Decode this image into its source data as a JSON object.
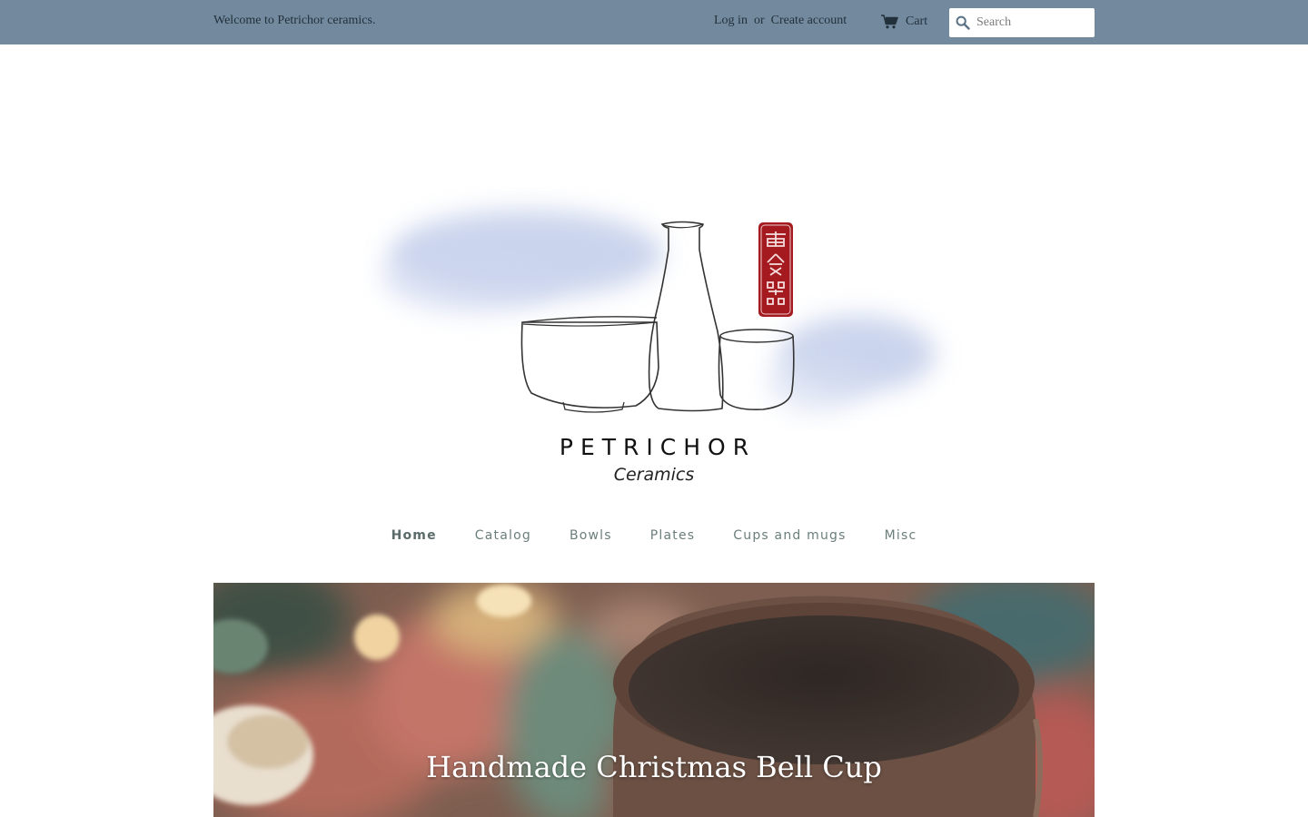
{
  "header": {
    "welcome": "Welcome to Petrichor ceramics.",
    "login_label": "Log in",
    "or_text": "or",
    "create_account_label": "Create account",
    "cart_label": "Cart",
    "cart_icon": "cart-icon",
    "search_icon": "search-icon",
    "search_placeholder": "Search",
    "bar_color": "#738a9e"
  },
  "logo": {
    "brand": "PETRICHOR",
    "subtitle": "Ceramics",
    "seal_color": "#a51a1f"
  },
  "nav": {
    "items": [
      {
        "label": "Home",
        "active": true
      },
      {
        "label": "Catalog"
      },
      {
        "label": "Bowls"
      },
      {
        "label": "Plates"
      },
      {
        "label": "Cups and mugs"
      },
      {
        "label": "Misc"
      }
    ]
  },
  "hero": {
    "title": "Handmade Christmas Bell Cup"
  }
}
